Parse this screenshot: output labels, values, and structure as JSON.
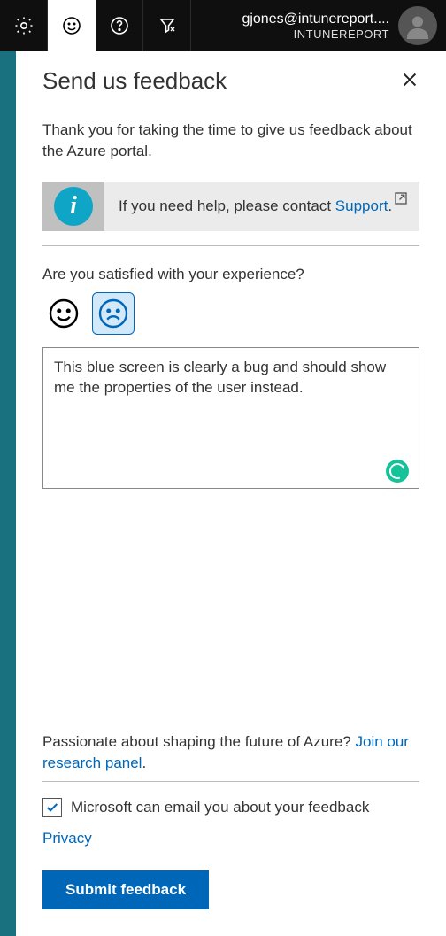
{
  "header": {
    "email": "gjones@intunereport....",
    "tenant": "INTUNEREPORT"
  },
  "panel": {
    "title": "Send us feedback",
    "intro": "Thank you for taking the time to give us feedback about the Azure portal.",
    "info_prefix": "If you need help, please contact ",
    "info_link": "Support",
    "info_suffix": ".",
    "question": "Are you satisfied with your experience?",
    "feedback_text": "This blue screen is clearly a bug and should show me the properties of the user instead.",
    "passion_prefix": "Passionate about shaping the future of Azure? ",
    "passion_link": "Join our research panel",
    "passion_suffix": ".",
    "email_opt_label": "Microsoft can email you about your feedback",
    "privacy_label": "Privacy",
    "submit_label": "Submit feedback"
  }
}
